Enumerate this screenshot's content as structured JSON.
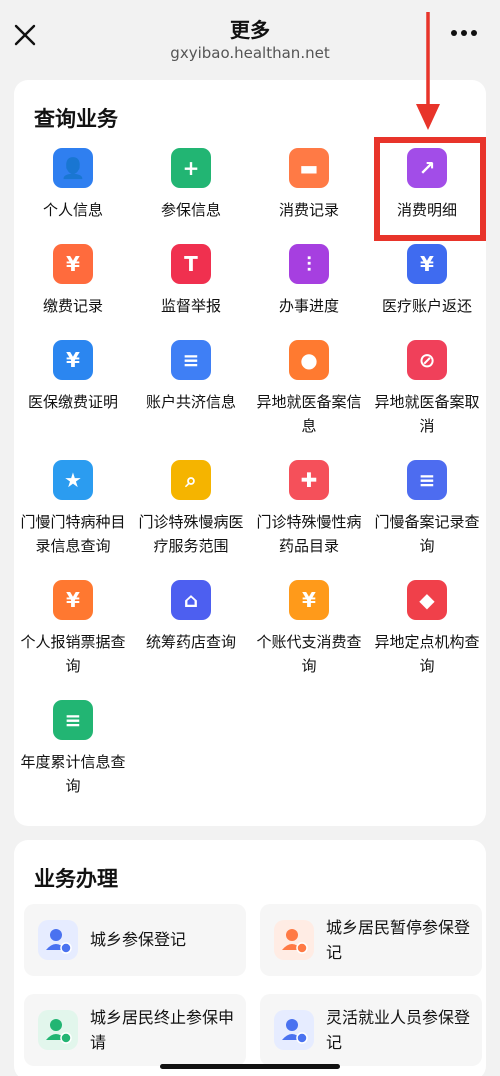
{
  "header": {
    "title": "更多",
    "url": "gxyibao.healthan.net"
  },
  "query_section": {
    "title": "查询业务",
    "items": [
      {
        "label": "个人信息",
        "icon": "person-card-icon",
        "color": "#2f7ff0"
      },
      {
        "label": "参保信息",
        "icon": "clipboard-plus-icon",
        "color": "#22b573"
      },
      {
        "label": "消费记录",
        "icon": "wallet-icon",
        "color": "#ff7a45"
      },
      {
        "label": "消费明细",
        "icon": "trend-chart-icon",
        "color": "#a24de8"
      },
      {
        "label": "缴费记录",
        "icon": "money-bag-icon",
        "color": "#ff6b3d"
      },
      {
        "label": "监督举报",
        "icon": "report-tag-icon",
        "color": "#f0304f"
      },
      {
        "label": "办事进度",
        "icon": "progress-sliders-icon",
        "color": "#a63fe0"
      },
      {
        "label": "医疗账户返还",
        "icon": "house-yen-icon",
        "color": "#3f6bf0"
      },
      {
        "label": "医保缴费证明",
        "icon": "shield-yen-icon",
        "color": "#2b86f0"
      },
      {
        "label": "账户共济信息",
        "icon": "document-icon",
        "color": "#3f7ff5"
      },
      {
        "label": "异地就医备案信息",
        "icon": "location-pin-icon",
        "color": "#ff7a30"
      },
      {
        "label": "异地就医备案取消",
        "icon": "location-cancel-icon",
        "color": "#f0405a"
      },
      {
        "label": "门慢门特病种目录信息查询",
        "icon": "star-card-icon",
        "color": "#2b9cf0"
      },
      {
        "label": "门诊特殊慢病医疗服务范围",
        "icon": "book-search-icon",
        "color": "#f5b400"
      },
      {
        "label": "门诊特殊慢性病药品目录",
        "icon": "medical-cross-icon",
        "color": "#f5505a"
      },
      {
        "label": "门慢备案记录查询",
        "icon": "clipboard-list-icon",
        "color": "#4d6cf0"
      },
      {
        "label": "个人报销票据查询",
        "icon": "receipt-yen-icon",
        "color": "#ff7830"
      },
      {
        "label": "统筹药店查询",
        "icon": "store-icon",
        "color": "#4d5ff0"
      },
      {
        "label": "个账代支消费查询",
        "icon": "coin-yen-icon",
        "color": "#ff9a1a"
      },
      {
        "label": "异地定点机构查询",
        "icon": "map-pin-icon",
        "color": "#f0404a"
      },
      {
        "label": "年度累计信息查询",
        "icon": "list-doc-icon",
        "color": "#22b573"
      }
    ]
  },
  "business_section": {
    "title": "业务办理",
    "items": [
      {
        "label": "城乡参保登记",
        "icon": "person-check-icon",
        "color": "#4a72f0",
        "bg": "#e6ecff"
      },
      {
        "label": "城乡居民暂停参保登记",
        "icon": "person-pause-icon",
        "color": "#ff7a45",
        "bg": "#ffece4"
      },
      {
        "label": "城乡居民终止参保申请",
        "icon": "person-minus-icon",
        "color": "#22b573",
        "bg": "#e2f6ec"
      },
      {
        "label": "灵活就业人员参保登记",
        "icon": "person-info-icon",
        "color": "#4a72f0",
        "bg": "#e6ecff"
      }
    ]
  }
}
